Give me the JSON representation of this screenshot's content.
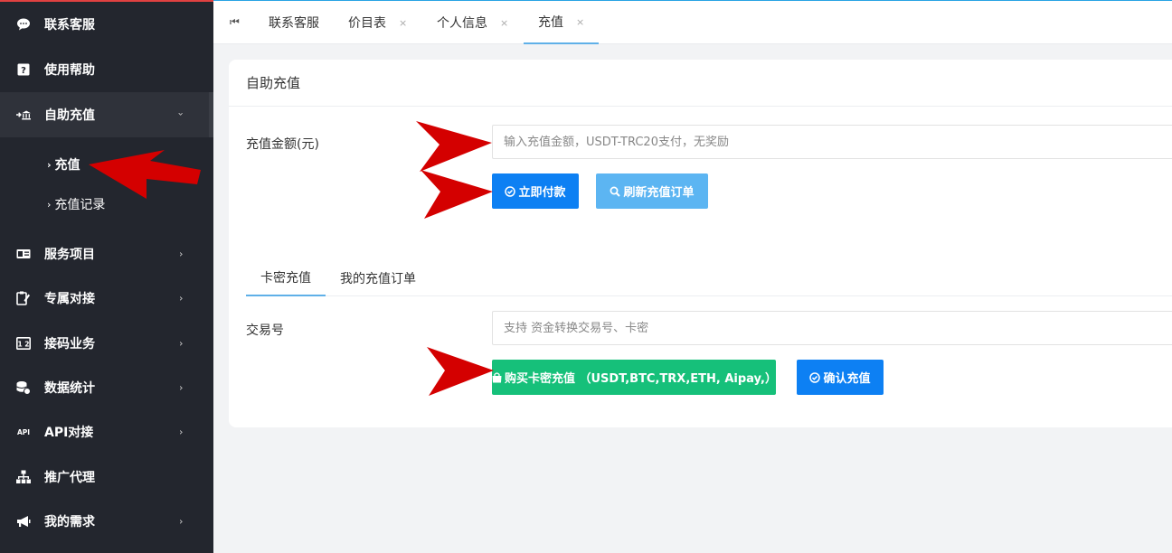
{
  "sidebar": {
    "items": [
      {
        "label": "联系客服",
        "icon": "chat-icon"
      },
      {
        "label": "使用帮助",
        "icon": "help-icon"
      },
      {
        "label": "自助充值",
        "icon": "recharge-icon"
      },
      {
        "label": "服务项目",
        "icon": "service-icon"
      },
      {
        "label": "专属对接",
        "icon": "dedicated-icon"
      },
      {
        "label": "接码业务",
        "icon": "sms-code-icon"
      },
      {
        "label": "数据统计",
        "icon": "database-icon"
      },
      {
        "label": "API对接",
        "icon": "api-icon"
      },
      {
        "label": "推广代理",
        "icon": "org-chart-icon"
      },
      {
        "label": "我的需求",
        "icon": "megaphone-icon"
      }
    ],
    "sub_items": [
      {
        "label": "充值"
      },
      {
        "label": "充值记录"
      }
    ]
  },
  "tabs": {
    "items": [
      {
        "label": "联系客服"
      },
      {
        "label": "价目表"
      },
      {
        "label": "个人信息"
      },
      {
        "label": "充值"
      }
    ],
    "close_glyph": "×"
  },
  "card": {
    "title": "自助充值",
    "amount_label": "充值金额(元)",
    "amount_placeholder": "输入充值金额，USDT-TRC20支付，无奖励",
    "pay_button": "立即付款",
    "refresh_button": "刷新充值订单",
    "subtabs": [
      {
        "label": "卡密充值"
      },
      {
        "label": "我的充值订单"
      }
    ],
    "txn_label": "交易号",
    "txn_placeholder": "支持 资金转换交易号、卡密",
    "buy_button": "购买卡密充值 （USDT,BTC,TRX,ETH, Aipay,）",
    "confirm_button": "确认充值"
  },
  "colors": {
    "sidebar_bg": "#23262e",
    "primary_blue": "#0d80f3",
    "light_blue": "#5cb5f2",
    "green": "#16c07a",
    "annotation_red": "#d40000"
  }
}
